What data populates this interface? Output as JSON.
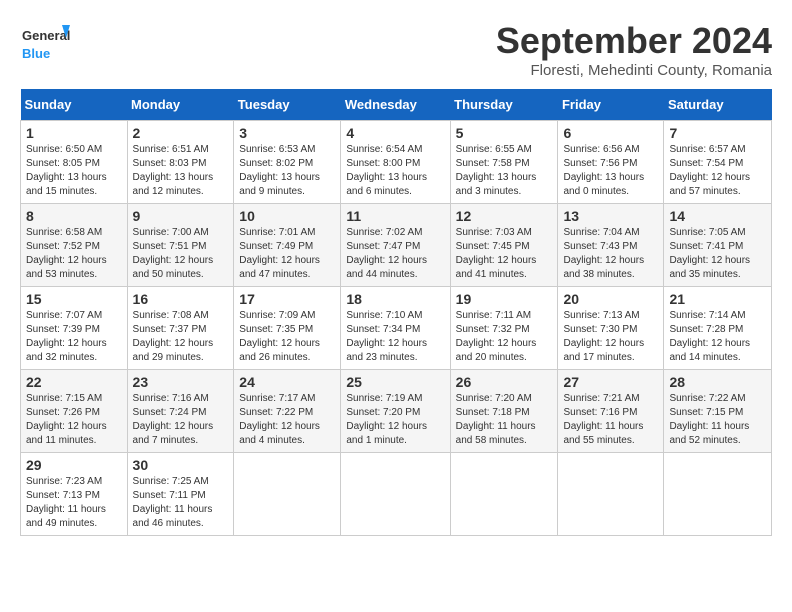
{
  "header": {
    "logo_general": "General",
    "logo_blue": "Blue",
    "title": "September 2024",
    "subtitle": "Floresti, Mehedinti County, Romania"
  },
  "days_of_week": [
    "Sunday",
    "Monday",
    "Tuesday",
    "Wednesday",
    "Thursday",
    "Friday",
    "Saturday"
  ],
  "weeks": [
    [
      {
        "day": 1,
        "info": "Sunrise: 6:50 AM\nSunset: 8:05 PM\nDaylight: 13 hours\nand 15 minutes."
      },
      {
        "day": 2,
        "info": "Sunrise: 6:51 AM\nSunset: 8:03 PM\nDaylight: 13 hours\nand 12 minutes."
      },
      {
        "day": 3,
        "info": "Sunrise: 6:53 AM\nSunset: 8:02 PM\nDaylight: 13 hours\nand 9 minutes."
      },
      {
        "day": 4,
        "info": "Sunrise: 6:54 AM\nSunset: 8:00 PM\nDaylight: 13 hours\nand 6 minutes."
      },
      {
        "day": 5,
        "info": "Sunrise: 6:55 AM\nSunset: 7:58 PM\nDaylight: 13 hours\nand 3 minutes."
      },
      {
        "day": 6,
        "info": "Sunrise: 6:56 AM\nSunset: 7:56 PM\nDaylight: 13 hours\nand 0 minutes."
      },
      {
        "day": 7,
        "info": "Sunrise: 6:57 AM\nSunset: 7:54 PM\nDaylight: 12 hours\nand 57 minutes."
      }
    ],
    [
      {
        "day": 8,
        "info": "Sunrise: 6:58 AM\nSunset: 7:52 PM\nDaylight: 12 hours\nand 53 minutes."
      },
      {
        "day": 9,
        "info": "Sunrise: 7:00 AM\nSunset: 7:51 PM\nDaylight: 12 hours\nand 50 minutes."
      },
      {
        "day": 10,
        "info": "Sunrise: 7:01 AM\nSunset: 7:49 PM\nDaylight: 12 hours\nand 47 minutes."
      },
      {
        "day": 11,
        "info": "Sunrise: 7:02 AM\nSunset: 7:47 PM\nDaylight: 12 hours\nand 44 minutes."
      },
      {
        "day": 12,
        "info": "Sunrise: 7:03 AM\nSunset: 7:45 PM\nDaylight: 12 hours\nand 41 minutes."
      },
      {
        "day": 13,
        "info": "Sunrise: 7:04 AM\nSunset: 7:43 PM\nDaylight: 12 hours\nand 38 minutes."
      },
      {
        "day": 14,
        "info": "Sunrise: 7:05 AM\nSunset: 7:41 PM\nDaylight: 12 hours\nand 35 minutes."
      }
    ],
    [
      {
        "day": 15,
        "info": "Sunrise: 7:07 AM\nSunset: 7:39 PM\nDaylight: 12 hours\nand 32 minutes."
      },
      {
        "day": 16,
        "info": "Sunrise: 7:08 AM\nSunset: 7:37 PM\nDaylight: 12 hours\nand 29 minutes."
      },
      {
        "day": 17,
        "info": "Sunrise: 7:09 AM\nSunset: 7:35 PM\nDaylight: 12 hours\nand 26 minutes."
      },
      {
        "day": 18,
        "info": "Sunrise: 7:10 AM\nSunset: 7:34 PM\nDaylight: 12 hours\nand 23 minutes."
      },
      {
        "day": 19,
        "info": "Sunrise: 7:11 AM\nSunset: 7:32 PM\nDaylight: 12 hours\nand 20 minutes."
      },
      {
        "day": 20,
        "info": "Sunrise: 7:13 AM\nSunset: 7:30 PM\nDaylight: 12 hours\nand 17 minutes."
      },
      {
        "day": 21,
        "info": "Sunrise: 7:14 AM\nSunset: 7:28 PM\nDaylight: 12 hours\nand 14 minutes."
      }
    ],
    [
      {
        "day": 22,
        "info": "Sunrise: 7:15 AM\nSunset: 7:26 PM\nDaylight: 12 hours\nand 11 minutes."
      },
      {
        "day": 23,
        "info": "Sunrise: 7:16 AM\nSunset: 7:24 PM\nDaylight: 12 hours\nand 7 minutes."
      },
      {
        "day": 24,
        "info": "Sunrise: 7:17 AM\nSunset: 7:22 PM\nDaylight: 12 hours\nand 4 minutes."
      },
      {
        "day": 25,
        "info": "Sunrise: 7:19 AM\nSunset: 7:20 PM\nDaylight: 12 hours\nand 1 minute."
      },
      {
        "day": 26,
        "info": "Sunrise: 7:20 AM\nSunset: 7:18 PM\nDaylight: 11 hours\nand 58 minutes."
      },
      {
        "day": 27,
        "info": "Sunrise: 7:21 AM\nSunset: 7:16 PM\nDaylight: 11 hours\nand 55 minutes."
      },
      {
        "day": 28,
        "info": "Sunrise: 7:22 AM\nSunset: 7:15 PM\nDaylight: 11 hours\nand 52 minutes."
      }
    ],
    [
      {
        "day": 29,
        "info": "Sunrise: 7:23 AM\nSunset: 7:13 PM\nDaylight: 11 hours\nand 49 minutes."
      },
      {
        "day": 30,
        "info": "Sunrise: 7:25 AM\nSunset: 7:11 PM\nDaylight: 11 hours\nand 46 minutes."
      },
      null,
      null,
      null,
      null,
      null
    ]
  ]
}
